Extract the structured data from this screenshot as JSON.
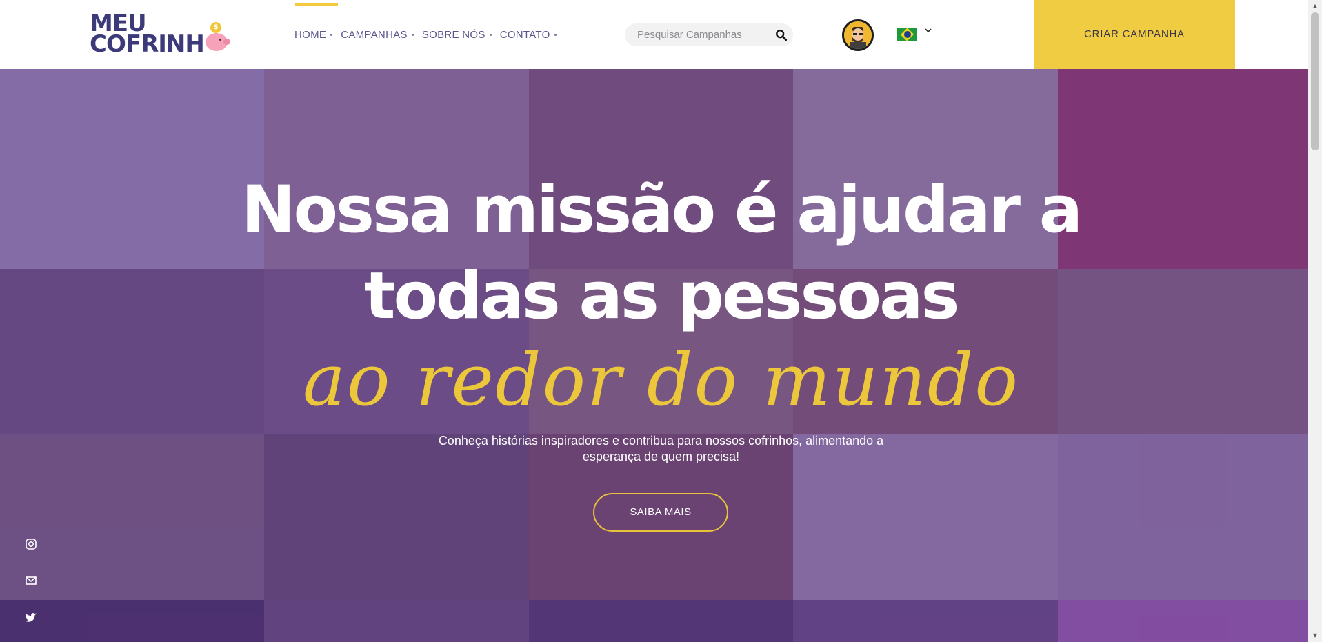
{
  "header": {
    "logo": {
      "line1": "MEU",
      "line2": "COFRINH",
      "coin_symbol": "$"
    },
    "nav": [
      {
        "label": "HOME"
      },
      {
        "label": "CAMPANHAS"
      },
      {
        "label": "SOBRE NÓS"
      },
      {
        "label": "CONTATO"
      }
    ],
    "search": {
      "placeholder": "Pesquisar Campanhas",
      "icon": "search-icon"
    },
    "avatar": "avatar",
    "language": {
      "flag": "brazil-flag-icon",
      "icon": "chevron-down-icon"
    },
    "cta_label": "CRIAR CAMPANHA",
    "colors": {
      "accent": "#f0cc43",
      "nav_text": "#5a568c",
      "brand": "#3d3a7a"
    }
  },
  "hero": {
    "title_line1": "Nossa missão é ajudar a",
    "title_line2": "todas as pessoas",
    "script_line": "ao redor do mundo",
    "subtitle": "Conheça histórias inspiradores e contribua para nossos cofrinhos, alimentando a esperança de quem precisa!",
    "button_label": "SAIBA MAIS",
    "overlay_color": "#5c3687"
  },
  "social": [
    {
      "icon": "instagram-icon"
    },
    {
      "icon": "mail-icon"
    },
    {
      "icon": "twitter-icon"
    }
  ]
}
